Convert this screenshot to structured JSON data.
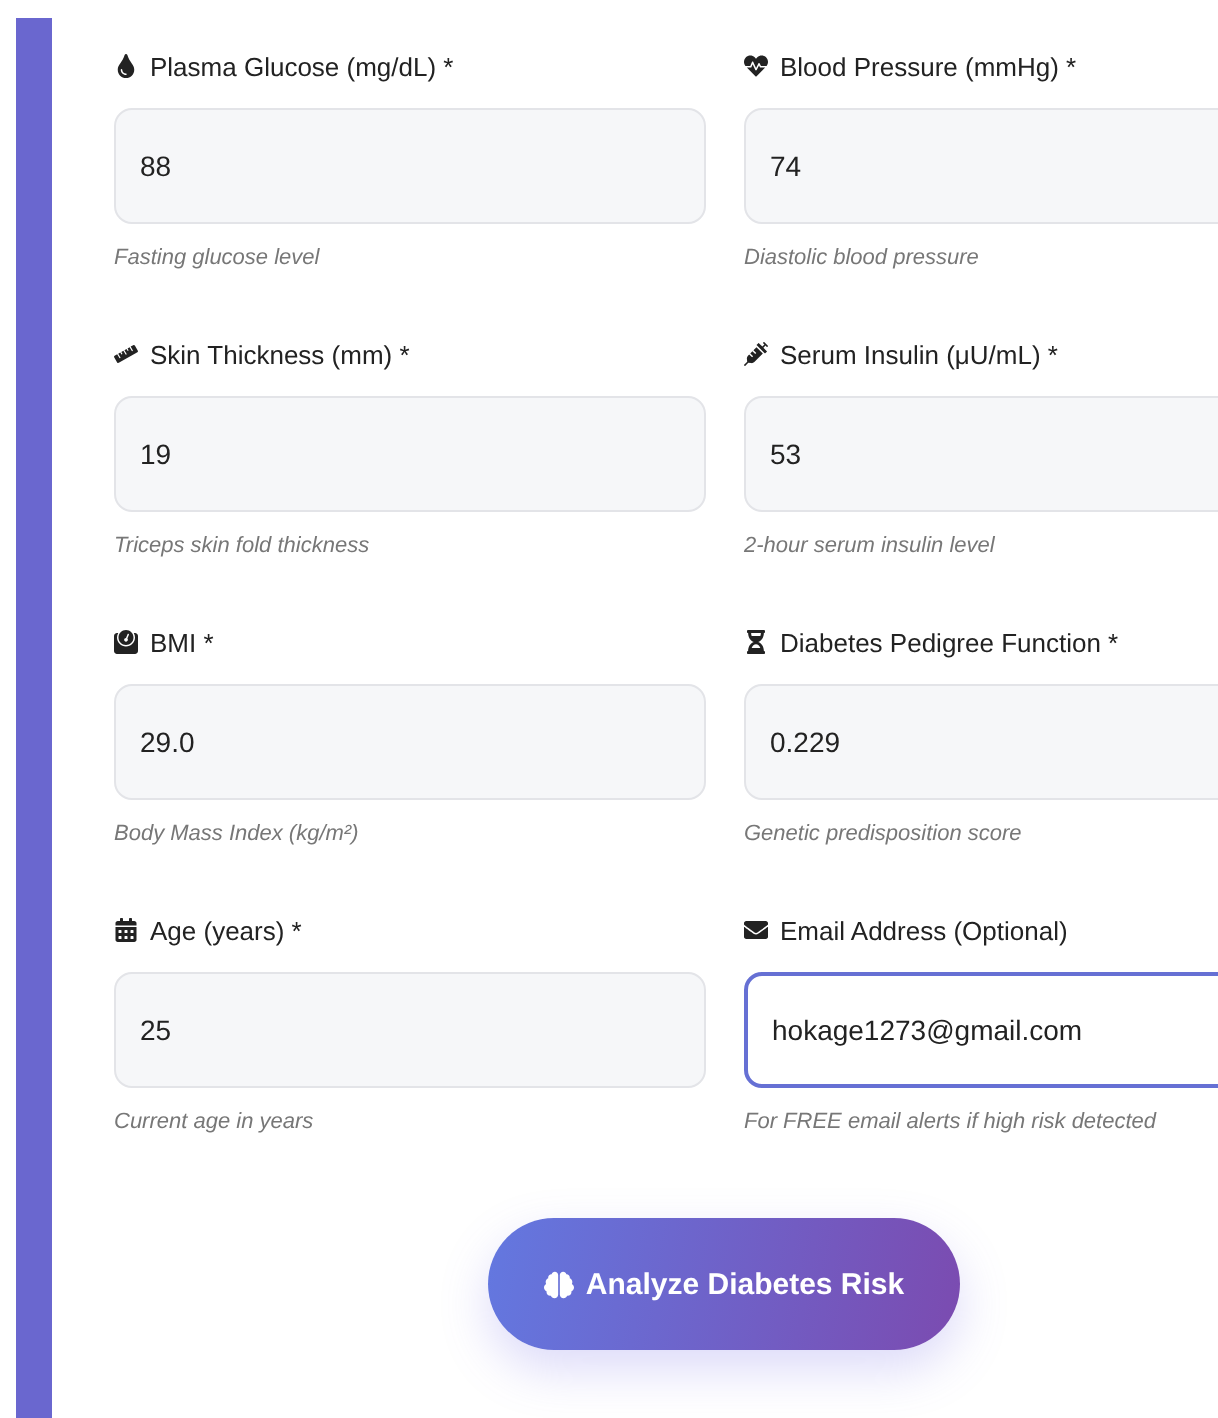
{
  "fields": [
    {
      "label": "Plasma Glucose (mg/dL) *",
      "value": "88",
      "help": "Fasting glucose level",
      "focused": false
    },
    {
      "label": "Blood Pressure (mmHg) *",
      "value": "74",
      "help": "Diastolic blood pressure",
      "focused": false
    },
    {
      "label": "Skin Thickness (mm) *",
      "value": "19",
      "help": "Triceps skin fold thickness",
      "focused": false
    },
    {
      "label": "Serum Insulin (μU/mL) *",
      "value": "53",
      "help": "2-hour serum insulin level",
      "focused": false
    },
    {
      "label": "BMI *",
      "value": "29.0",
      "help": "Body Mass Index (kg/m²)",
      "focused": false
    },
    {
      "label": "Diabetes Pedigree Function *",
      "value": "0.229",
      "help": "Genetic predisposition score",
      "focused": false
    },
    {
      "label": "Age (years) *",
      "value": "25",
      "help": "Current age in years",
      "focused": false
    },
    {
      "label": "Email Address (Optional)",
      "value": "hokage1273@gmail.com",
      "help": "For FREE email alerts if high risk detected",
      "focused": true
    }
  ],
  "submit_button": {
    "label": "Analyze Diabetes Risk"
  }
}
